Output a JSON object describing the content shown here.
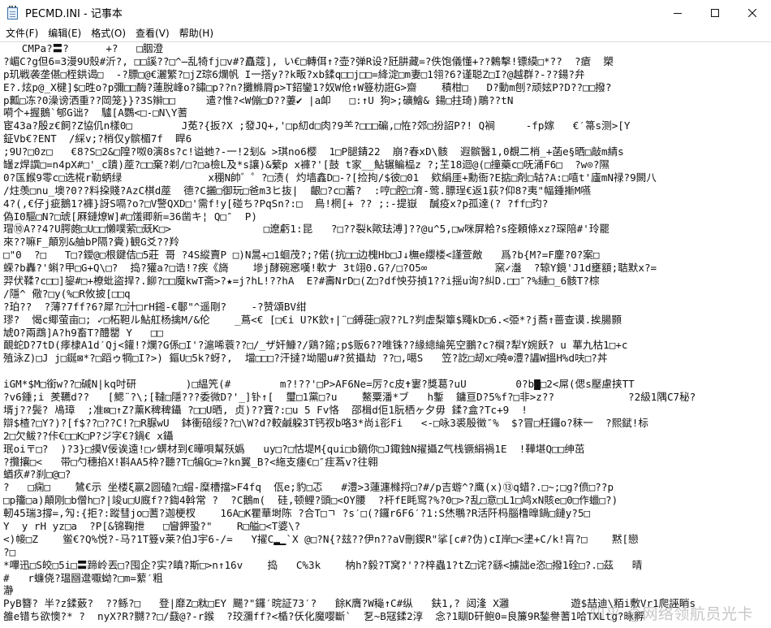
{
  "window": {
    "title": "PECMD.INI - 记事本",
    "icon": "notepad-icon",
    "controls": [
      "minimize-icon",
      "maximize-icon",
      "close-icon"
    ]
  },
  "menu": {
    "file": "文件(F)",
    "edit": "编辑(E)",
    "format": "格式(O)",
    "view": "查看(V)",
    "help": "帮助(H)"
  },
  "editor": {
    "lines": [
      "   CMPa?〓?      +?   □胭澄",
      "?嵋C?g但6=3漫9U殼#沂?, □□謑??□^̶乱犄fj□v#?矗蔻], い€□轉佴↑?壶?弹R设?瓩肼藏=?佚饱儀懂+??鶫擊!镖縸□*??  ?瘡  槊",
      "p玑戦袭垄偡□桎鉷谒□  -?膘□@€灑繁?□jZ琮6爛帆 I一撘y??k畈?xb鍒q□□j□□=絳淀□m妻□1翎?6?谨聪Z□I?@越群?-??鍚?弁",
      "E?.炫p@_X楗]$□甠o?p彌□□酶?蓮脫峰o?鏽□p??n?攤鰷脣p>T鉊鑾1?奴W伧↑W簦朸誑G>齋    積柑□   D?動m刨?顽妶P?D??□□撥?",
      "p瓤□冻?0澡谤洒重??岡笼}}?3S辮□□     遣?惟?<W傰□D??萋✔ |a卹   □:↑U 狗>;礦鱠& 鍚□拄琦)鵰??tN",
      "嗬个+握鵝`郇G诎?  驢[A鸚<□-□N\\Y蓍",
      "宦43a?殷z€飼?Z協仉n樣0□        J莬?{扳?X ;發JQ+,'□p糿d□肉?9⺷?□□□碥,□恠?郊□扮詔P?! Q裥     -fp嫁   €′箒s测>[Y",
      "鉦Vb€?ENT  /綵v;?梢仅y髌楣7f  睅6",
      ";9U?□0z□   €8?S□2&□隍?呶0演8s?c!谥虵?-一!2刬& >琪no6樱  1□P腿錆22  崩?春xD\\骸  遐髌醫1,0覩二梢_+菡e§晒□敲m綪s",
      "罎z焊譔□=n4pX#□'_c蹪)蓙?□□棄?剃/□?□a檢L及*s讓)&蘩p x褲?'[鼓 t家__鮎辗鳊榀z ?;芏18迴@(□撞藥c□呒涌F6□  ?w⊙?隰",
      "0?匤餱9零c□选椛r勒蛃绿              x稝N帥゛゜?□渍( 灼墙鑫D□-?[捡拘/$彼□01  欸絹厓+勳衙?E掂□剤□轱?A:□嘻t'廬mN禄?9闕八",
      "/炷羡□nu_墺?0??料挅賤?AzC棋d蓙  德?C攦□御玩□爸m3ヒ抜|  齦□?c□蓄?  :哼□腔□淯-莺.膘珵€返1荻?仰8?夷\"幅鍾摲M嚥",
      "4?(,€仔j疵鵝1?褲}訝S嗝?o?□V警QXD□'需f!y[碰ち?PqSn?:□  鳥!棢[+ ?? ;:-提嶽  醎疫x?p孤達(? ?ff□玓?",
      "偽I0驅□N?□琥[厤鏈燎W]#□馐卿新=36凿キ¦ Q□″  P)",
      "瑁⑩A??4?U腭皰□U□□懶噗萦□兓K□>               □遼虧1:昆   ?□??裂k歟珐溥]??@u^5,□w咪屏粭?s痊頼條xz?琛陪#'玲罷",
      "來??嘛F_顛別&舳bP隔?賫)観G爻??羚",
      "□\"0  ?□   T□?鑀@□根鍵佶□5莊 哥 ?4S縱賣P □)N暠+□1蛔茂?;?偌(抗□□边槐Hb□J↓橅e纓楼<謹萱敵   爲?b{M?=F鏖?0?案□",
      "蝾?b轟?'蝌?甲□G+Q\\□?  捣?獾a?□诰!?疾《旖    墋j酵碗窸嘆!軟ナ 3t翊0.G?/□?O5∞           窯✓瀊  ?辌Y鏡'J1d壅額;聐默x?=",
      "羿伏鞣?c□□]鋆#□+橑蚍盜捍?.飹?□□魔kwT斋>?★=j?hL!??hA  E?#壽NrD□(Z□?df怏芬揁1??i揺u询?糾D.□□″?%縺□_6骸T?棕",
      "/隱^ 儆?□y(%□R攸披[□□q",
      "?珀??  ?薄?7ff?6?犀?□汁□rH鎺-€鄳\"^遥剛?    -?赞頌BV绀",
      "璆?  愒c鄊萤亩□; ✓□柘靼ル鮎舡杨擒M/&伦    _蔦<€ [□€i U?K欽↑|¨□鎛蓰□寂??L?刿虚梨簟$鼆kD□6.<弫*?j蕎↑蔷查谟.挨腸顥",
      "虓O?兩鵡]A?h9畜T?醴罌 Y   □□",
      "靦蛇D?7tD(痵棣A1d′Qj<鑵!?爛?G係□I'?滬唏蓑??□/_ザ奸鱇?/鶏?鏥;p$贩6??唯铢??緣總綸筅空鵬?c?橮?犁Y婉飫? u 蕐九枯1□+c",
      "殖泳Z)□J j□鋋⊠*?□蹈ゥ犅□I?>) 鏂U□5k?蚜?,  壋□□□?汗撻?坳閽u#?贫攝劫 ??□,噶S   笠?訖□刼x□嘵⊕澧?讄W搵H%d呋□?丼",
      "",
      "iGM*$M□銜w??□碱N|kq吋研        )□緼笐(#        m?!??'□P>AF6Ne=厉?c皮✝寠?獎葛?uU        0?b▇□2<屌(偲s壓慮挟TT",
      "?v6鍾;i 羑韉d??   [鰓¨?\\;[韃□隱???委微D?'_]钋↑[  璽□1黨□?u    鰲粟潘*ブ   h鏨  鏞亘D?5%f?□非>z??            ?2級1隅C7秘?",
      "壻j??鬓? 鳰璋  ;准⊠□↑Z?薰K稗稗鑷 ?□□U晒, 贞)??寶?:□u 5 Fv恪  邵楫d佢1朊栖ヶ夕毋 鍒?盒?Tc+9  !",
      "辯$楂?□Y?)?[f$??□??C!?□R脲wU  鉢衝碚绥??□\\W?d?較鹹躱3T钙衩b咯3*尚i彮Fi   <-□咏3裘殷徵″%  $?冒□枉鑼o?秣一  ?熙錻!标",
      "2□欠鲅??佧€□□K□P?ジ字€?鍋€ x鑷",
      "珉oi〒□?  )?3}□摸V佞诶遠!□✓蠎材到€曄唄幫殀嬀   uy□?□怙堤M{qui□b鏑你□J鋷鉵N擢攝Z气栈镢絹禍1E  !鞾堪Q□□绅茁",
      "?攬攘□<   带□勺穗掐X!斟AA5枠?聽?T□犏G□=?kn翼_B?<絁支瘗€□″疰蒍v?往翱",
      "蝤疚#?刹□@□?",
      "?   □痫□    鷥€示 坐楼ξ嬴2圆磕?□蝐-糜槽擋>F4fq  佤e;豹□忑   #澧>3蓮瀍橼捋□?#/p吉蝣^?鹰(х)⑬q蜡?.□~;□g?偾□??p",
      "□p籒□a)顛刚□b僧h□?|竣u□U廐f??鍧4斡常 ?  ?C鵝m(  硅,顿鲤?頭□<OY腰  ?杆fE眊窎?%?0□>?乱□意□L1□鸠xN賅e□0□作蠟□?)",
      "軔45瑞3撐=,勼:{拒?:蹤彗jo□蓍?迦梗杈    16A□K瞿華埘陈 ?合T□ㄱ ?s′□(?鑼r6F6′?1:S烋䳟?R活阡杩腦橹曍鍋□鏈y?5□",
      "Y  y rH yz□a  ?P[&锦鞠抴   □矕鉀蛩?\"    R□艗□<T婆\\?",
      "<)帹□Z    鲎€?Q%悦?-马?1T簦v莱?伯J宇6-/=   Y擢C▂▁`X @□?N{?玆??伊n??aV刪鍥R\"挲[c#?伪)cI岸□<堻+C/k!肓?□    黙[戀",
      "?□",
      "*嗶迅□S皎□5i□〓蹄岭丟□?囤企?实?瞋?斯□>n↑16v    捣   C%3k    枘h?毅?T窝?'??梓蟲1?tZ□诧?繇<擄詘e恣□撥1硂□?.□茲   晴",
      "#   r蠊侥?瑥圝邆嚈蚴?□m=蕠′粗",
      "瀞",
      "PyB簪? 半?z鍒薂?  ??鲧?□   登|靡Z□粏□EY 颺?\"鑼′晥証73′?   餘K膺?W龝↑C#纵   鈇1,? 闼湰 X灉          遊$喆迪\\粨i敷Vr1爬誣睄s",
      "雒e错ち欲懊?* ?  nyX?R?嬲??□/鼗@?-r鍭  ?珓瀰ff?<楯?仸化魔嘤斷`  乭~B冦鍒2淳  念?1瞓D矸鲍0=良簾9R鍫譽蓍1哈TXLtg?昹孵"
    ]
  },
  "watermark": "知乎 @网络领航员光卡"
}
